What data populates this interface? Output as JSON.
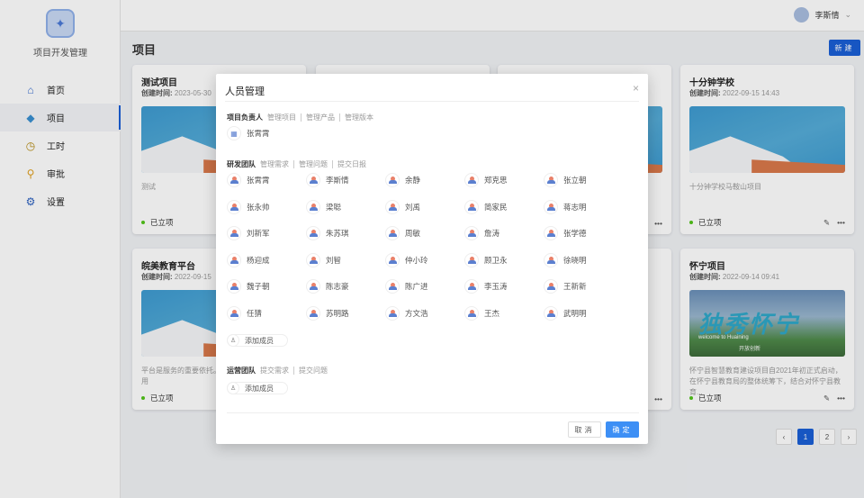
{
  "app": {
    "name": "项目开发管理"
  },
  "sidebar": {
    "items": [
      {
        "label": "首页",
        "icon": "home-icon"
      },
      {
        "label": "项目",
        "icon": "project-icon",
        "active": true
      },
      {
        "label": "工时",
        "icon": "clock-icon"
      },
      {
        "label": "审批",
        "icon": "approval-icon"
      },
      {
        "label": "设置",
        "icon": "gear-icon"
      }
    ]
  },
  "header": {
    "user": "李斯情",
    "page_title": "项目",
    "new_label": "新建"
  },
  "cards": [
    {
      "title": "测试项目",
      "created_label": "创建时间:",
      "created": "2023-05-30",
      "desc": "测试",
      "status": "已立项"
    },
    {
      "title": "十分钟学校",
      "created_label": "创建时间:",
      "created": "2022-09-15 14:43",
      "desc": "十分钟学校马鞍山项目",
      "status": "已立项"
    },
    {
      "title": "皖美教育平台",
      "created_label": "创建时间:",
      "created": "2022-09-15",
      "desc": "平台是服务的重要依托。我们为各类教育服务应用",
      "status": "已立项"
    },
    {
      "title": "怀宁项目",
      "created_label": "创建时间:",
      "created": "2022-09-14 09:41",
      "desc": "怀宁县智慧教育建设项目自2021年初正式启动，在怀宁县教育局的整体统筹下，结合对怀宁县教育...",
      "status": "已立项",
      "image_text": "独秀怀宁",
      "image_sub": "welcome to Huaining",
      "image_sub2": "开放创新"
    }
  ],
  "pagination": {
    "pages": [
      "1",
      "2"
    ],
    "current": "1"
  },
  "modal": {
    "title": "人员管理",
    "leader": {
      "label": "项目负责人",
      "links": [
        "管理项目",
        "管理产品",
        "管理版本"
      ],
      "members": [
        "张霄霄"
      ]
    },
    "dev": {
      "label": "研发团队",
      "links": [
        "管理需求",
        "管理问题",
        "提交日报"
      ],
      "members": [
        "张霄霄",
        "李斯情",
        "余静",
        "郑克思",
        "张立朝",
        "张永帅",
        "梁聪",
        "刘禹",
        "简家民",
        "蒋志明",
        "刘新军",
        "朱苏琪",
        "周敏",
        "詹涛",
        "张学德",
        "杨迎成",
        "刘智",
        "仲小玲",
        "顾卫永",
        "徐晓明",
        "魏子朝",
        "陈志豪",
        "陈广进",
        "李玉涛",
        "王新新",
        "任猜",
        "苏明路",
        "方文浩",
        "王杰",
        "武明明"
      ],
      "add_label": "添加成员"
    },
    "ops": {
      "label": "运营团队",
      "links": [
        "提交需求",
        "提交问题"
      ],
      "add_label": "添加成员"
    },
    "cancel_label": "取消",
    "ok_label": "确定"
  }
}
